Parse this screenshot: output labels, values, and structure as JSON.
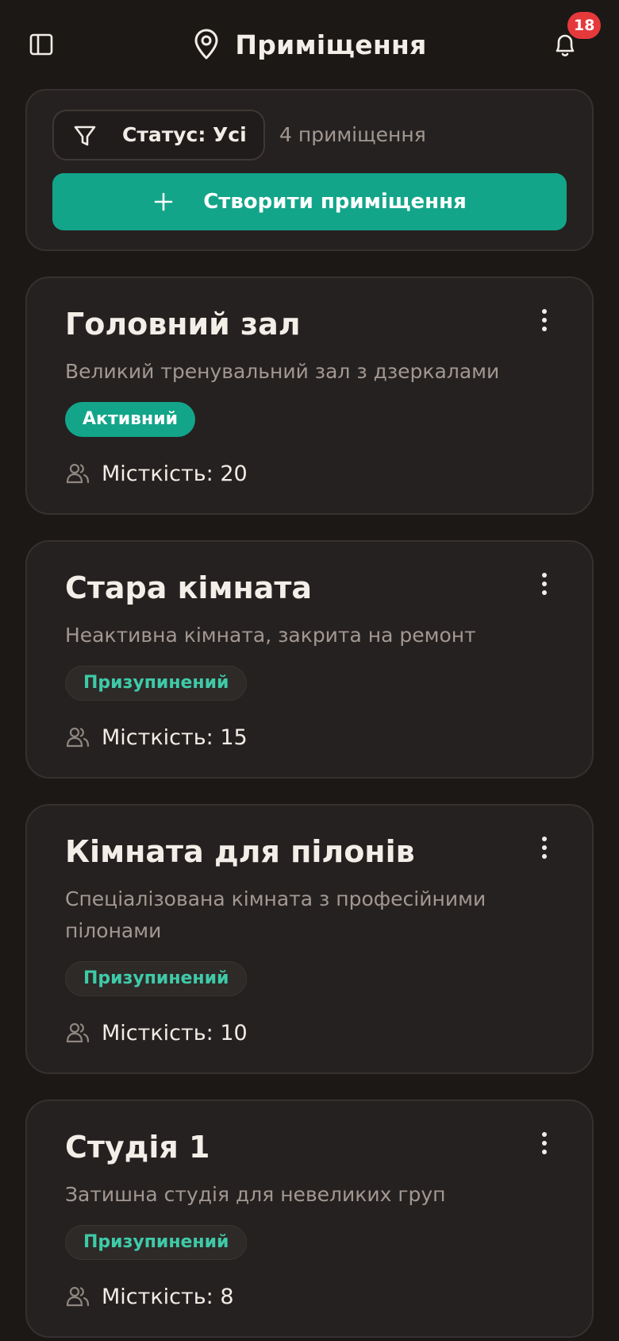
{
  "header": {
    "title": "Приміщення",
    "notifications_count": "18"
  },
  "toolbar": {
    "filter_label": "Статус: Усі",
    "count_text": "4 приміщення",
    "create_label": "Створити приміщення"
  },
  "rooms": [
    {
      "name": "Головний зал",
      "description": "Великий тренувальний зал з дзеркалами",
      "status": "Активний",
      "capacity": "Місткість: 20"
    },
    {
      "name": "Стара кімната",
      "description": "Неактивна кімната, закрита на ремонт",
      "status": "Призупинений",
      "capacity": "Місткість: 15"
    },
    {
      "name": "Кімната для пілонів",
      "description": "Спеціалізована кімната з професійними пілонами",
      "status": "Призупинений",
      "capacity": "Місткість: 10"
    },
    {
      "name": "Студія 1",
      "description": "Затишна студія для невеликих груп",
      "status": "Призупинений",
      "capacity": "Місткість: 8"
    }
  ],
  "colors": {
    "background": "#1c1816",
    "card": "#252120",
    "accent": "#13a589",
    "badge": "#e5393b"
  }
}
